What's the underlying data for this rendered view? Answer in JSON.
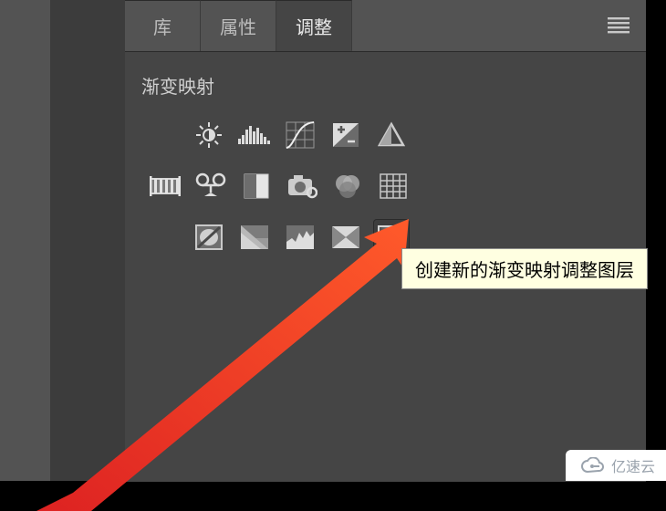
{
  "tabs": {
    "lib": "库",
    "props": "属性",
    "adjust": "调整"
  },
  "heading": "渐变映射",
  "tooltip": "创建新的渐变映射调整图层",
  "watermark": "亿速云",
  "icons": {
    "r1": [
      "brightness-contrast",
      "levels",
      "curves",
      "exposure",
      "vibrance"
    ],
    "r2": [
      "hue-saturation",
      "color-balance",
      "black-white",
      "photo-filter",
      "channel-mixer",
      "color-lookup"
    ],
    "r3": [
      "invert",
      "posterize",
      "threshold",
      "selective-color",
      "gradient-map"
    ]
  }
}
